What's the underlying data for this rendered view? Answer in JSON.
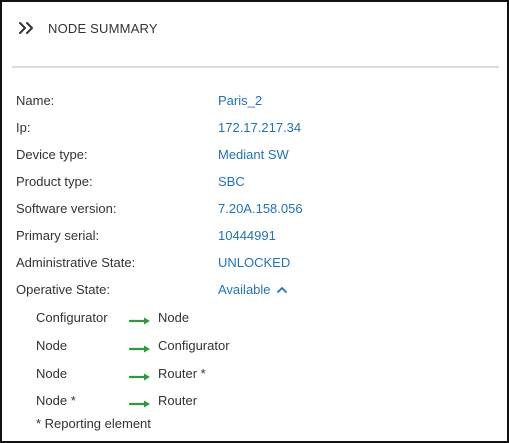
{
  "panel": {
    "expand_icon": "double-chevron-right-icon",
    "title": "NODE SUMMARY"
  },
  "fields": [
    {
      "label": "Name:",
      "value": "Paris_2"
    },
    {
      "label": "Ip:",
      "value": "172.17.217.34"
    },
    {
      "label": "Device type:",
      "value": "Mediant SW"
    },
    {
      "label": "Product type:",
      "value": "SBC"
    },
    {
      "label": "Software version:",
      "value": "7.20A.158.056"
    },
    {
      "label": "Primary serial:",
      "value": "10444991"
    },
    {
      "label": "Administrative State:",
      "value": "UNLOCKED"
    },
    {
      "label": "Operative State:",
      "value": "Available",
      "icon": "chevron-up-icon"
    }
  ],
  "flows": [
    {
      "from": "Configurator",
      "to": "Node",
      "icon": "right-arrow-icon"
    },
    {
      "from": "Node",
      "to": "Configurator",
      "icon": "right-arrow-icon"
    },
    {
      "from": "Node",
      "to": "Router *",
      "icon": "right-arrow-icon"
    },
    {
      "from": "Node *",
      "to": "Router",
      "icon": "right-arrow-icon"
    }
  ],
  "footnote": "* Reporting element",
  "colors": {
    "value_text": "#1e73be",
    "arrow": "#2e9b3b",
    "label_text": "#333333",
    "divider": "#d7dde3",
    "border": "#111111"
  }
}
